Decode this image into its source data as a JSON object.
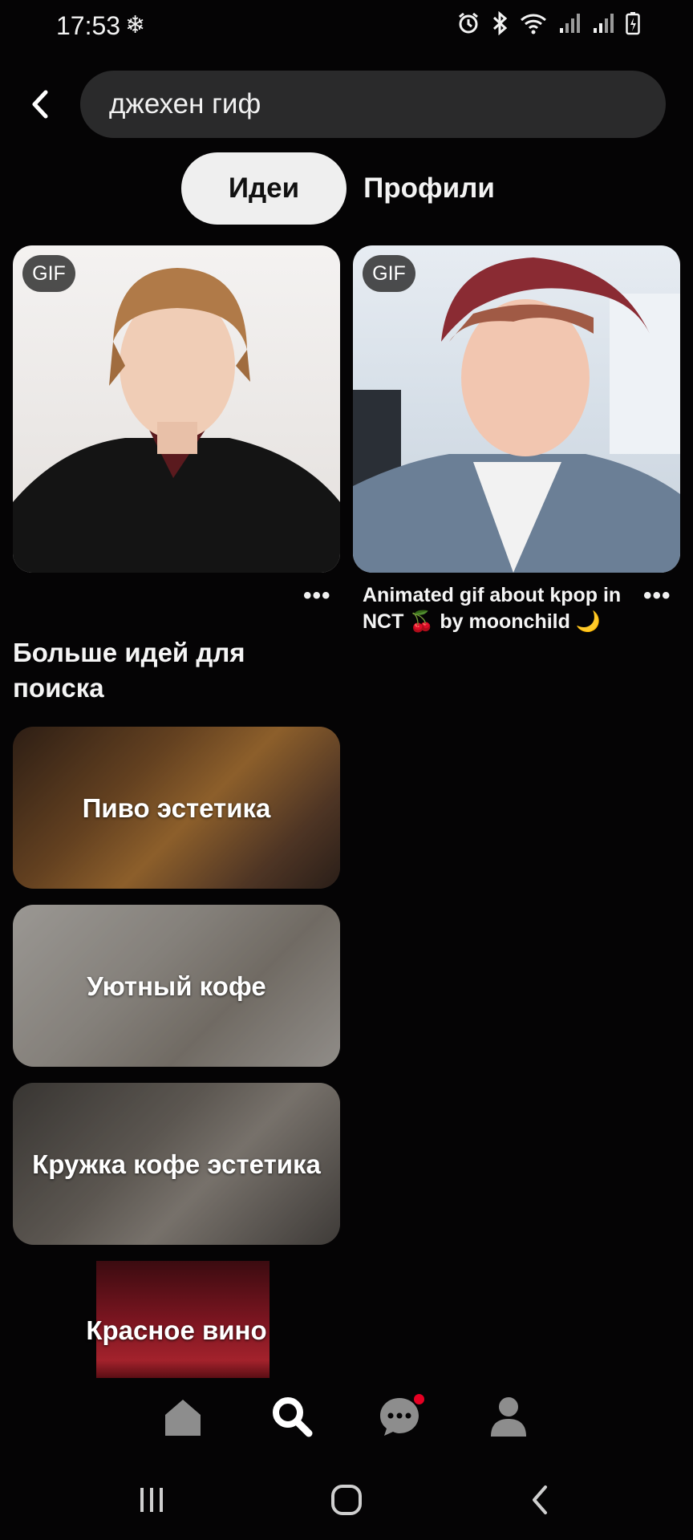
{
  "status_bar": {
    "time": "17:53",
    "fan_symbol": "❄",
    "icons": [
      "alarm-icon",
      "bluetooth-icon",
      "wifi-icon",
      "signal-icon",
      "signal-icon",
      "battery-charging-icon"
    ]
  },
  "search": {
    "query": "джехен гиф"
  },
  "tabs": [
    {
      "label": "Идеи",
      "active": true
    },
    {
      "label": "Профили",
      "active": false
    }
  ],
  "pins": [
    {
      "badge": "GIF",
      "more": "•••",
      "caption": ""
    },
    {
      "badge": "GIF",
      "more": "•••",
      "caption": "Animated gif about kpop in NCT 🍒 by moonchild 🌙"
    }
  ],
  "more_ideas": {
    "title": "Больше идей для поиска",
    "items": [
      {
        "label": "Пиво эстетика"
      },
      {
        "label": "Уютный кофе"
      },
      {
        "label": "Кружка кофе эстетика"
      },
      {
        "label": "Красное вино"
      }
    ]
  },
  "bottom_nav": {
    "items": [
      "home-icon",
      "search-icon",
      "messages-icon",
      "profile-icon"
    ],
    "active": "search-icon",
    "notification_color": "#e60023"
  },
  "system_nav": [
    "recent-apps-icon",
    "home-circle-icon",
    "back-chevron-icon"
  ],
  "colors": {
    "background": "#050405",
    "search_box": "#2a2a2b",
    "active_tab": "#efefef"
  }
}
